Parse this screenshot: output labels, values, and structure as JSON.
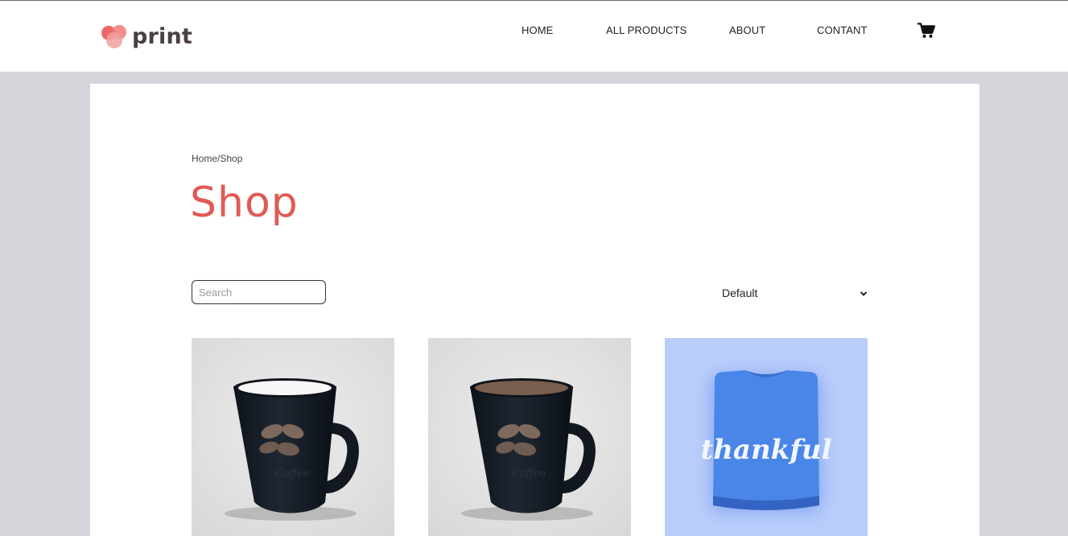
{
  "header": {
    "logo_text": "print",
    "nav": [
      {
        "label": "HOME"
      },
      {
        "label": "ALL PRODUCTS"
      },
      {
        "label": "ABOUT"
      },
      {
        "label": "CONTANT"
      }
    ],
    "cart_icon": "shopping-cart-icon"
  },
  "main": {
    "breadcrumb": {
      "home": "Home",
      "separator": "/",
      "current": "Shop"
    },
    "title": "Shop",
    "search": {
      "placeholder": "Search",
      "value": ""
    },
    "sort": {
      "selected": "Default",
      "icon": "chevron-down-icon"
    },
    "products": [
      {
        "image": "black coffee mug with white interior",
        "print_text": "Coffee"
      },
      {
        "image": "black coffee mug with brown interior",
        "print_text": "Coffee"
      },
      {
        "image": "folded blue t-shirt",
        "print_text": "thankful"
      }
    ]
  },
  "colors": {
    "accent": "#e05a55",
    "background": "#d4d5da",
    "tshirt_bg": "#b9cdfb",
    "tshirt": "#4a86e8"
  }
}
